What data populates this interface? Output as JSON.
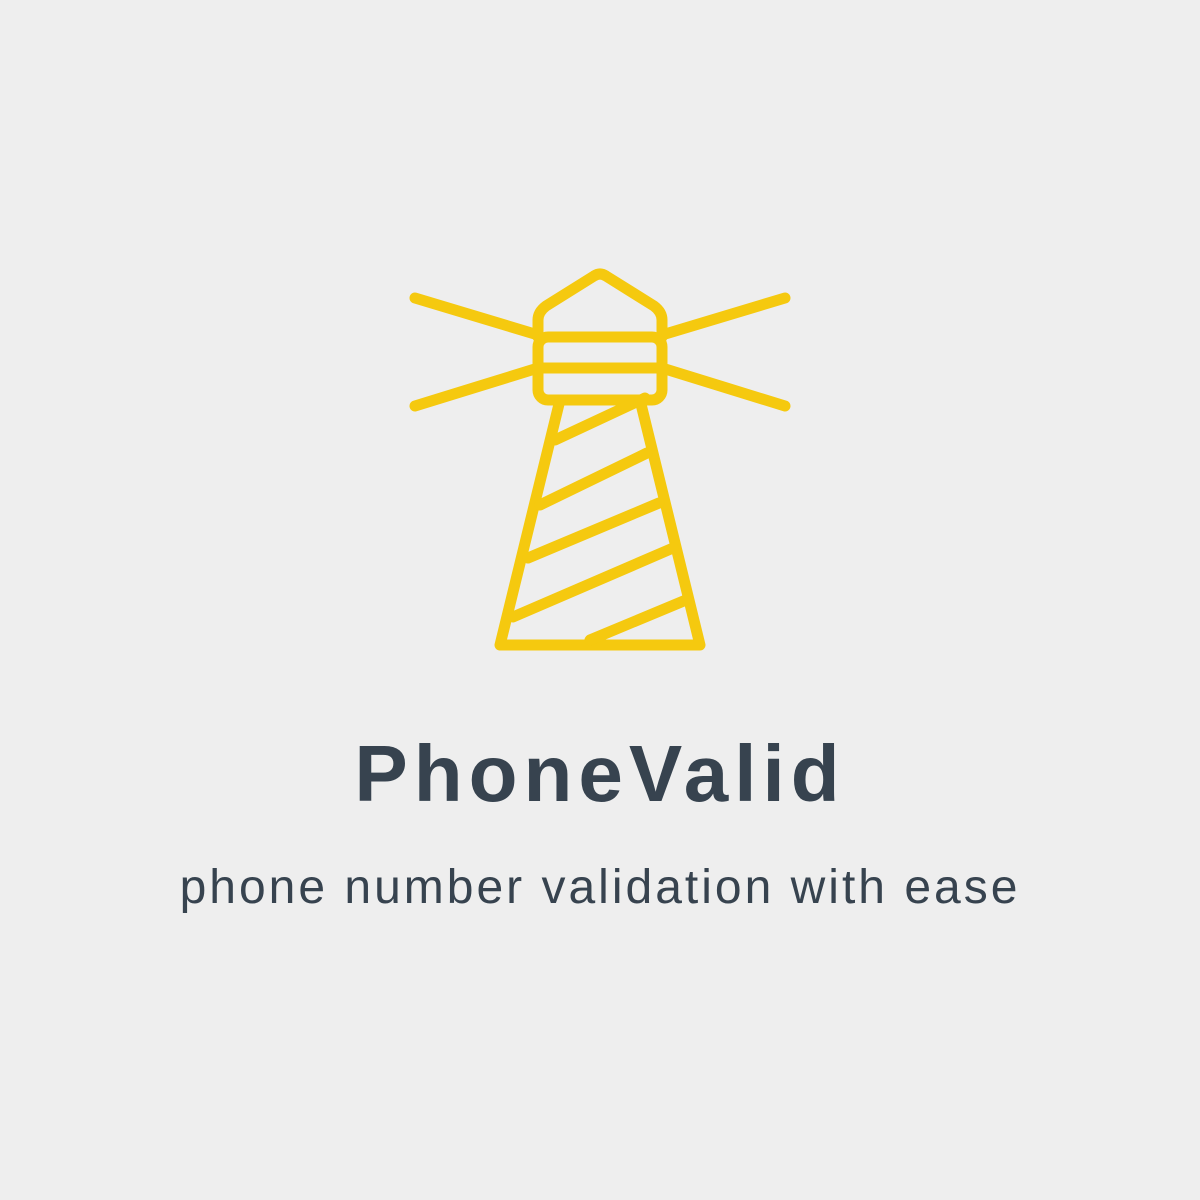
{
  "logo": {
    "icon": "lighthouse-icon",
    "color": "#f5c90f"
  },
  "brand": {
    "name": "PhoneValid",
    "tagline": "phone number validation with ease",
    "text_color": "#37434f"
  },
  "background": "#eeeeee"
}
